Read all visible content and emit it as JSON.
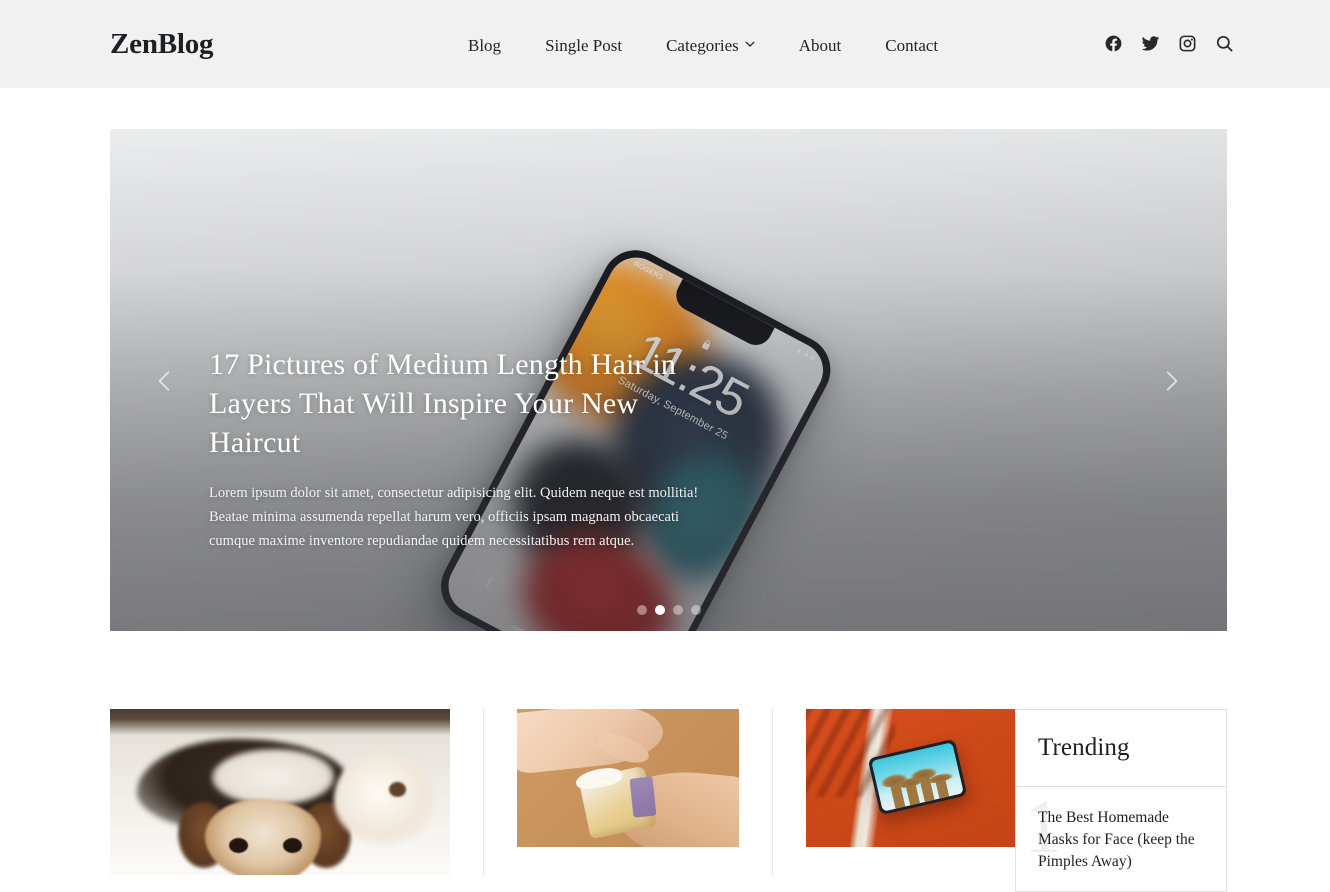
{
  "site": {
    "logo": "ZenBlog"
  },
  "nav": {
    "items": [
      {
        "label": "Blog",
        "has_dropdown": false
      },
      {
        "label": "Single Post",
        "has_dropdown": false
      },
      {
        "label": "Categories",
        "has_dropdown": true
      },
      {
        "label": "About",
        "has_dropdown": false
      },
      {
        "label": "Contact",
        "has_dropdown": false
      }
    ]
  },
  "header_icons": [
    {
      "name": "facebook-icon",
      "label": "Facebook"
    },
    {
      "name": "twitter-icon",
      "label": "Twitter"
    },
    {
      "name": "instagram-icon",
      "label": "Instagram"
    },
    {
      "name": "search-icon",
      "label": "Search"
    }
  ],
  "hero": {
    "title": "17 Pictures of Medium Length Hair in Layers That Will Inspire Your New Haircut",
    "description": "Lorem ipsum dolor sit amet, consectetur adipisicing elit. Quidem neque est mollitia! Beatae minima assumenda repellat harum vero, officiis ipsam magnam obcaecati cumque maxime inventore repudiandae quidem necessitatibus rem atque.",
    "prev_label": "Previous slide",
    "next_label": "Next slide",
    "slide_count": 4,
    "active_slide": 2,
    "phone": {
      "time": "11:25",
      "date": "Saturday, September 25",
      "carrier": "ROGERS"
    }
  },
  "cards": [
    {
      "name": "card-puppy",
      "alt": "Beagle puppy lying on a white blanket beside a plush toy"
    },
    {
      "name": "card-cake",
      "alt": "Two hands passing a slice of cake on a tan background"
    },
    {
      "name": "card-tablet",
      "alt": "Tablet lying on an orange sports court with palm shadows"
    }
  ],
  "trending": {
    "title": "Trending",
    "items": [
      {
        "rank": "1",
        "title": "The Best Homemade Masks for Face (keep the Pimples Away)"
      }
    ]
  },
  "colors": {
    "header_bg": "#f1f1f1",
    "text": "#1d1f22",
    "border": "#e2e2e2",
    "trend_numeral": "#efefef"
  }
}
